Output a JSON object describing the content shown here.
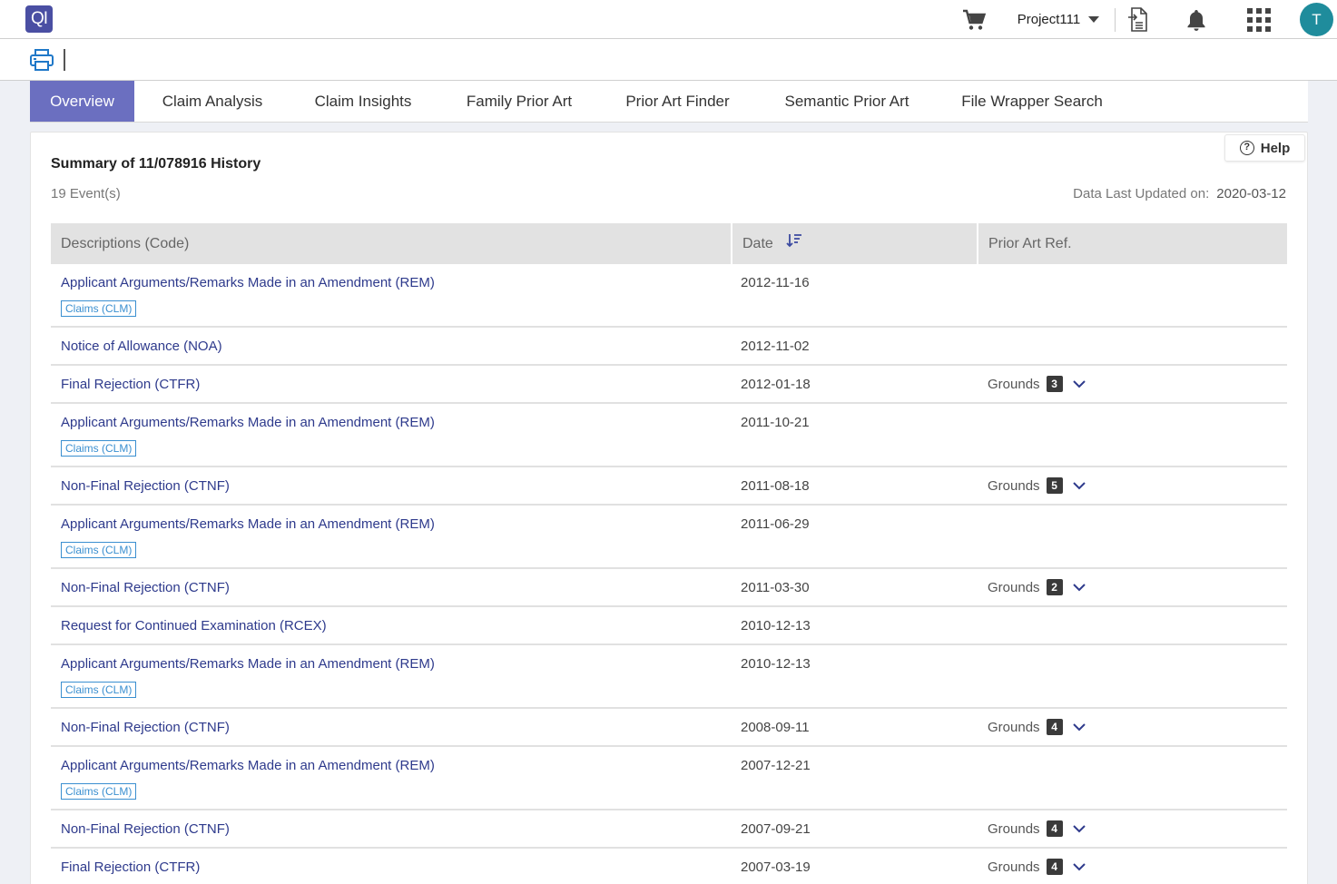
{
  "header": {
    "logo_text": "QI",
    "project_label": "Project111",
    "avatar_letter": "T"
  },
  "tabs": [
    {
      "label": "Overview"
    },
    {
      "label": "Claim Analysis"
    },
    {
      "label": "Claim Insights"
    },
    {
      "label": "Family Prior Art"
    },
    {
      "label": "Prior Art Finder"
    },
    {
      "label": "Semantic Prior Art"
    },
    {
      "label": "File Wrapper Search"
    }
  ],
  "summary": {
    "help_label": "Help",
    "title": "Summary of 11/078916 History",
    "events": "19 Event(s)",
    "updated_label": "Data Last Updated on:",
    "updated_value": "2020-03-12"
  },
  "table": {
    "headers": [
      "Descriptions (Code)",
      "Date",
      "Prior Art Ref."
    ],
    "rows": [
      {
        "desc": "Applicant Arguments/Remarks Made in an Amendment (REM)",
        "tag": "Claims (CLM)",
        "date": "2012-11-16"
      },
      {
        "desc": "Notice of Allowance (NOA)",
        "date": "2012-11-02"
      },
      {
        "desc": "Final Rejection (CTFR)",
        "date": "2012-01-18",
        "grounds_label": "Grounds",
        "grounds_count": "3"
      },
      {
        "desc": "Applicant Arguments/Remarks Made in an Amendment (REM)",
        "tag": "Claims (CLM)",
        "date": "2011-10-21"
      },
      {
        "desc": "Non-Final Rejection (CTNF)",
        "date": "2011-08-18",
        "grounds_label": "Grounds",
        "grounds_count": "5"
      },
      {
        "desc": "Applicant Arguments/Remarks Made in an Amendment (REM)",
        "tag": "Claims (CLM)",
        "date": "2011-06-29"
      },
      {
        "desc": "Non-Final Rejection (CTNF)",
        "date": "2011-03-30",
        "grounds_label": "Grounds",
        "grounds_count": "2"
      },
      {
        "desc": "Request for Continued Examination (RCEX)",
        "date": "2010-12-13"
      },
      {
        "desc": "Applicant Arguments/Remarks Made in an Amendment (REM)",
        "tag": "Claims (CLM)",
        "date": "2010-12-13"
      },
      {
        "desc": "Non-Final Rejection (CTNF)",
        "date": "2008-09-11",
        "grounds_label": "Grounds",
        "grounds_count": "4"
      },
      {
        "desc": "Applicant Arguments/Remarks Made in an Amendment (REM)",
        "tag": "Claims (CLM)",
        "date": "2007-12-21"
      },
      {
        "desc": "Non-Final Rejection (CTNF)",
        "date": "2007-09-21",
        "grounds_label": "Grounds",
        "grounds_count": "4"
      },
      {
        "desc": "Final Rejection (CTFR)",
        "date": "2007-03-19",
        "grounds_label": "Grounds",
        "grounds_count": "4"
      }
    ]
  },
  "colors": {
    "brand": "#4a4fa3",
    "active_tab": "#6b6fc0",
    "link": "#2e3a8c",
    "tag": "#3a8fd0",
    "avatar": "#1f8c9c"
  }
}
